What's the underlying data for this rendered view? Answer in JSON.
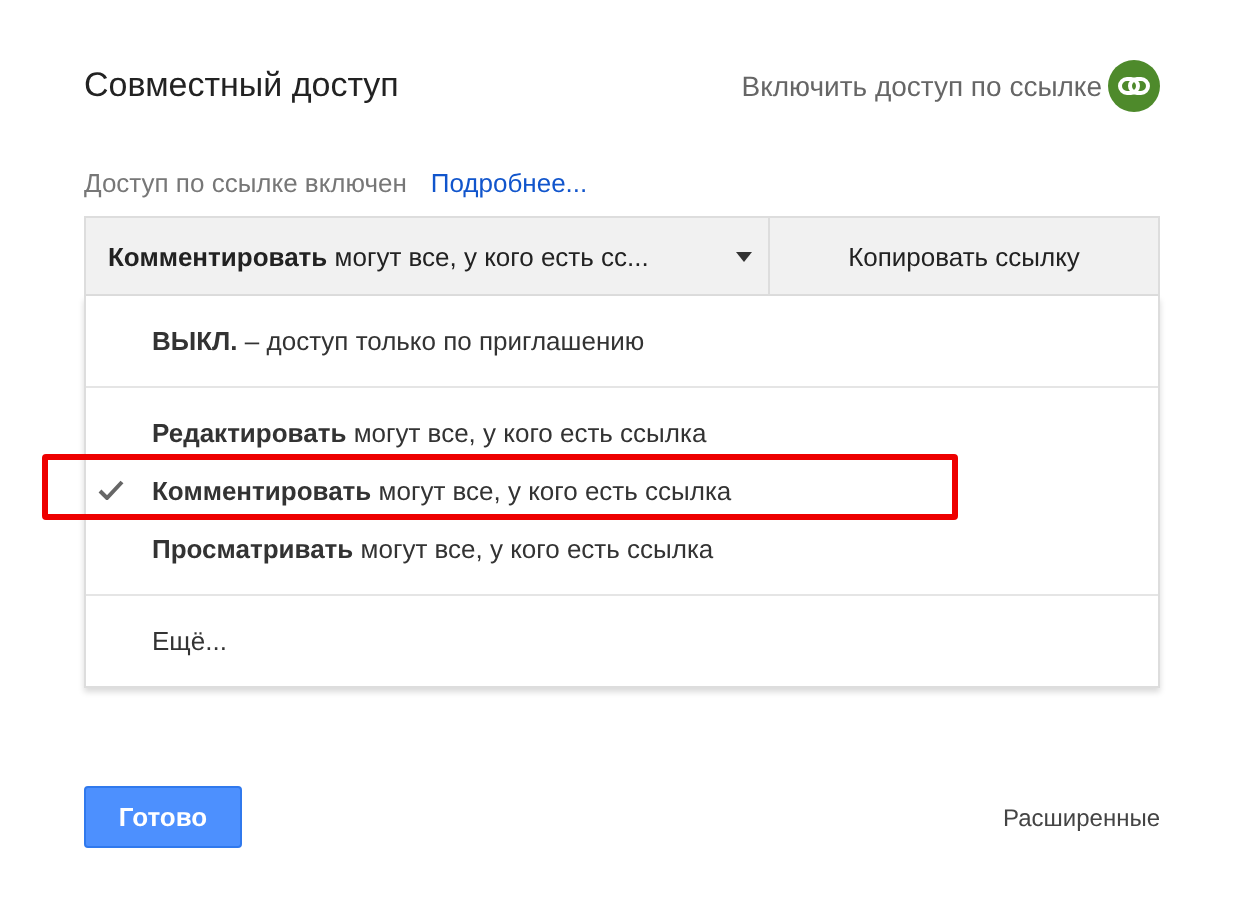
{
  "dialog": {
    "title": "Совместный доступ",
    "link_toggle": {
      "label": "Включить доступ по ссылке",
      "on": true
    }
  },
  "status": {
    "text": "Доступ по ссылке включен",
    "link": "Подробнее..."
  },
  "access_dropdown": {
    "value": "**Комментировать** могут все, у кого есть сс..."
  },
  "copy_button": "Копировать ссылку",
  "menu": {
    "groups": [
      [
        {
          "text": "**ВЫКЛ.** – доступ только по приглашению",
          "selected": false
        }
      ],
      [
        {
          "text": "**Редактировать** могут все, у кого есть ссылка",
          "selected": false
        },
        {
          "text": "**Комментировать** могут все, у кого есть ссылка",
          "selected": true
        },
        {
          "text": "**Просматривать** могут все, у кого есть ссылка",
          "selected": false
        }
      ],
      [
        {
          "text": "Ещё...",
          "selected": false
        }
      ]
    ]
  },
  "done_button": "Готово",
  "advanced_link": "Расширенные"
}
